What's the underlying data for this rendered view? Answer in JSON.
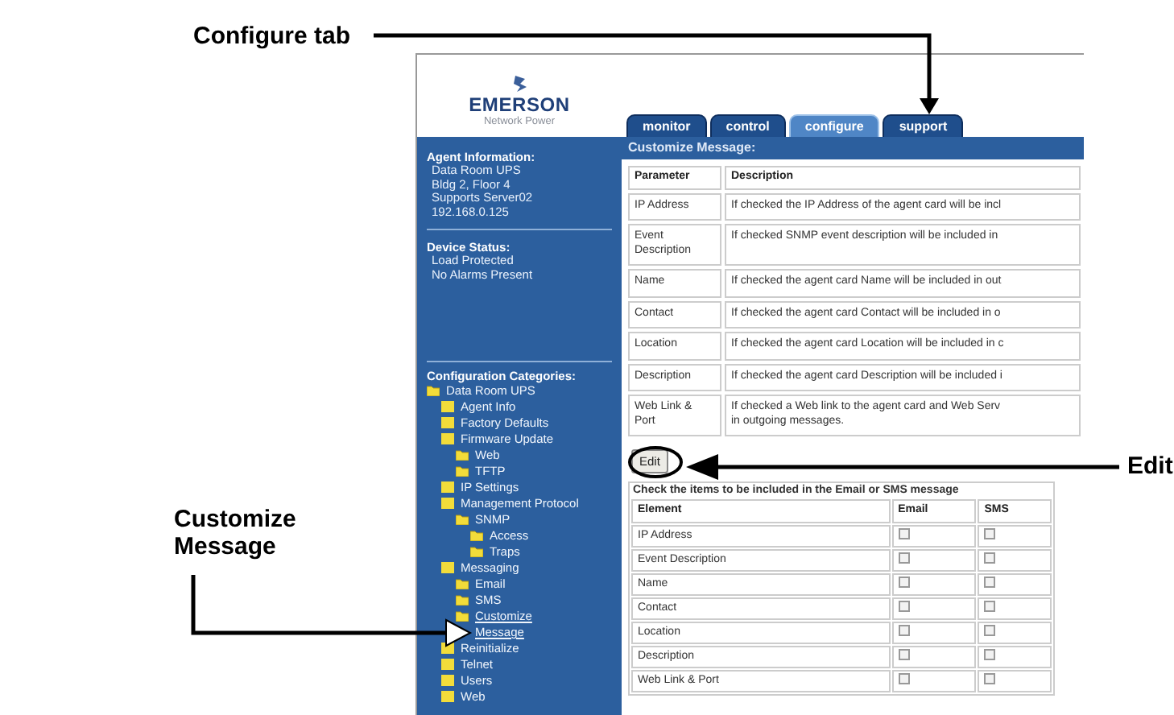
{
  "callouts": [
    {
      "kind": "configure",
      "text": "Configure tab"
    },
    {
      "kind": "edit",
      "text": "Edit"
    },
    {
      "kind": "customize",
      "text": "Customize Message"
    }
  ],
  "logo": {
    "brand": "EMERSON",
    "tagline": "Network Power"
  },
  "tabs": [
    {
      "label": "monitor",
      "selected": false
    },
    {
      "label": "control",
      "selected": false
    },
    {
      "label": "configure",
      "selected": true
    },
    {
      "label": "support",
      "selected": false
    }
  ],
  "sidebar": {
    "agent_information": {
      "heading": "Agent Information:",
      "lines": [
        "Data Room UPS",
        "Bldg 2, Floor 4",
        "Supports Server02",
        "192.168.0.125"
      ]
    },
    "device_status": {
      "heading": "Device Status:",
      "lines": [
        "Load Protected",
        "No Alarms Present"
      ]
    },
    "configuration_categories": {
      "heading": "Configuration Categories:",
      "tree": [
        {
          "label": "Data Room UPS",
          "selected": false,
          "children": [
            {
              "label": "Agent Info",
              "selected": false
            },
            {
              "label": "Factory Defaults",
              "selected": false
            },
            {
              "label": "Firmware Update",
              "selected": false,
              "children": [
                {
                  "label": "Web",
                  "selected": false
                },
                {
                  "label": "TFTP",
                  "selected": false
                }
              ]
            },
            {
              "label": "IP Settings",
              "selected": false
            },
            {
              "label": "Management Protocol",
              "selected": false,
              "children": [
                {
                  "label": "SNMP",
                  "selected": false,
                  "children": [
                    {
                      "label": "Access",
                      "selected": false
                    },
                    {
                      "label": "Traps",
                      "selected": false
                    }
                  ]
                }
              ]
            },
            {
              "label": "Messaging",
              "selected": false,
              "children": [
                {
                  "label": "Email",
                  "selected": false
                },
                {
                  "label": "SMS",
                  "selected": false
                },
                {
                  "label": "Customize\nMessage",
                  "selected": true
                }
              ]
            },
            {
              "label": "Reinitialize",
              "selected": false
            },
            {
              "label": "Telnet",
              "selected": false
            },
            {
              "label": "Users",
              "selected": false
            },
            {
              "label": "Web",
              "selected": false
            }
          ]
        }
      ]
    }
  },
  "content": {
    "heading": "Customize Message:",
    "parameter_table": {
      "columns": [
        "Parameter",
        "Description"
      ],
      "rows": [
        {
          "parameter": "IP Address",
          "description": "If checked the IP Address of the agent card will be incl"
        },
        {
          "parameter": "Event\nDescription",
          "description": "If checked SNMP event description will be included in"
        },
        {
          "parameter": "Name",
          "description": "If checked the agent card Name will be included in out"
        },
        {
          "parameter": "Contact",
          "description": "If checked the agent card Contact will be included in o"
        },
        {
          "parameter": "Location",
          "description": "If checked the agent card Location will be included in c"
        },
        {
          "parameter": "Description",
          "description": "If checked the agent card Description will be included i"
        },
        {
          "parameter": "Web Link &\nPort",
          "description": "If checked a Web link to the agent card and Web Serv\nin outgoing messages."
        }
      ]
    },
    "edit_button": "Edit",
    "element_table": {
      "caption": "Check the items to be included in the Email or SMS message",
      "columns": [
        "Element",
        "Email",
        "SMS"
      ],
      "rows": [
        {
          "element": "IP Address",
          "email": false,
          "sms": false
        },
        {
          "element": "Event Description",
          "email": false,
          "sms": false
        },
        {
          "element": "Name",
          "email": false,
          "sms": false
        },
        {
          "element": "Contact",
          "email": false,
          "sms": false
        },
        {
          "element": "Location",
          "email": false,
          "sms": false
        },
        {
          "element": "Description",
          "email": false,
          "sms": false
        },
        {
          "element": "Web Link & Port",
          "email": false,
          "sms": false
        }
      ]
    }
  }
}
